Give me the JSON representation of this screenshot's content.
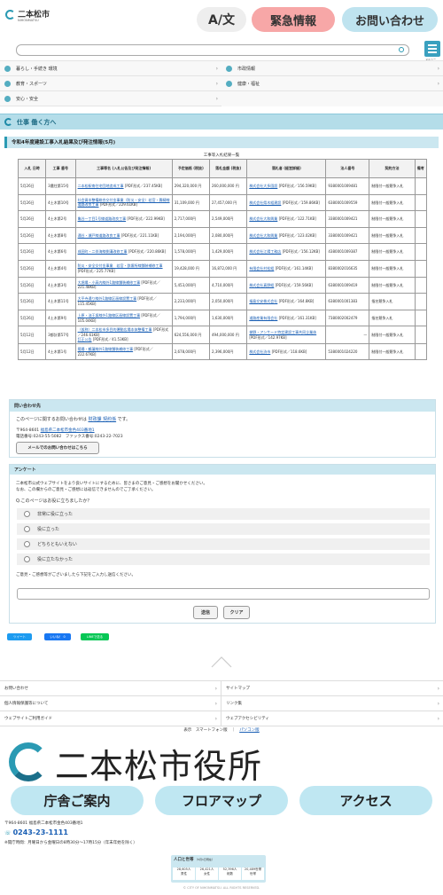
{
  "header": {
    "logo_text": "二本松市",
    "logo_sub": "NIHONMATSU",
    "lang_label": "A/文",
    "emergency_label": "緊急情報",
    "contact_label": "お問い合わせ",
    "menu_label": "メニュー"
  },
  "nav": [
    {
      "label": "暮らし・手続き 環境"
    },
    {
      "label": "市政情報"
    },
    {
      "label": "教育・スポーツ"
    },
    {
      "label": "健康・福祉"
    },
    {
      "label": "安心・安全"
    }
  ],
  "section_title": "仕事 働く方へ",
  "page_heading": "令和4年度建設工事入札結果及び発注情報(5月)",
  "table_caption": "工事等入札結果一覧",
  "table_headers": [
    "入札 日時",
    "工事 番号",
    "工事等名 (入札公告及び発注情報)",
    "予定価格 (税抜)",
    "落札金額 (税抜)",
    "落札者 (経営詳細)",
    "法人番号",
    "契約方法",
    "備考"
  ],
  "rows": [
    {
      "date": "5月26日",
      "no": "3農住第15号",
      "name_link": "二本松駅南住宅団地造成工事",
      "name_extra": " [PDF形式／237.45KB]",
      "price": "294,320,000 円",
      "bid": "260,000,000 円",
      "winner_link": "株式会社大多園設",
      "winner_extra": " [PDF形式／156.59KB]",
      "corp": "9380001009481",
      "method": "制限付一般競争入札",
      "note": ""
    },
    {
      "date": "5月26日",
      "no": "4土木第10号",
      "name_link": "社会資本整備総合交付金事業（防災・安全）若宮・舞騎線道路改良工事",
      "name_extra": " [PDF形式／229.61KB]",
      "price": "31,109,000 円",
      "bid": "27,457,000 円",
      "winner_link": "株式会社県木組建設",
      "winner_extra": " [PDF形式／159.86KB]",
      "corp": "6380001009559",
      "method": "制限付一般競争入札",
      "note": ""
    },
    {
      "date": "5月26日",
      "no": "4土木第2号",
      "name_link": "亀谷一丁目1号線道路改良工事",
      "name_extra": " [PDF形式／222.99KB]",
      "price": "2,717,000円",
      "bid": "2,549,000円",
      "winner_link": "株式会社大和興業",
      "winner_extra": " [PDF形式／122.71KB]",
      "corp": "3380001009421",
      "method": "制限付一般競争入札",
      "note": ""
    },
    {
      "date": "5月26日",
      "no": "4土木第8号",
      "name_link": "通谷・瀬戸線道路改良工事",
      "name_extra": " [PDF形式／221.11KB]",
      "price": "2,194,000円",
      "bid": "2,080,000円",
      "winner_link": "株式会社大和興業",
      "winner_extra": " [PDF形式／123.02KB]",
      "corp": "3380001009421",
      "method": "制限付一般競争入札",
      "note": ""
    },
    {
      "date": "5月26日",
      "no": "4土木第6号",
      "name_link": "成田町・二伴海線側溝改修工事",
      "name_extra": " [PDF形式／220.86KB]",
      "price": "1,578,000円",
      "bid": "1,429,000円",
      "winner_link": "株式会社江陽工務店",
      "winner_extra": " [PDF形式／156.12KB]",
      "corp": "4380001009387",
      "method": "制限付一般競争入札",
      "note": ""
    },
    {
      "date": "5月26日",
      "no": "4土木第4号",
      "name_link": "防災・安全交付金事業　若宮・鉄塀所線舗装補修工事",
      "name_extra": " [PDF形式／225.77KB]",
      "price": "19,428,000 円",
      "bid": "16,872,000 円",
      "winner_link": "有限会社村松組",
      "winner_extra": " [PDF形式／161.14KB]",
      "corp": "8380002016635",
      "method": "制限付一般競争入札",
      "note": ""
    },
    {
      "date": "5月26日",
      "no": "4土木第3号",
      "name_link": "大堀場・小高内線外1路線舗装補修工事",
      "name_extra": " [PDF形式／221.48KB]",
      "price": "5,453,000円",
      "bid": "4,710,000円",
      "winner_link": "株式会社真野組",
      "winner_extra": " [PDF形式／159.56KB]",
      "corp": "6380001009419",
      "method": "制限付一般競争入札",
      "note": ""
    },
    {
      "date": "5月26日",
      "no": "4土木第11号",
      "name_link": "大平寺通り線外1路線区画線設置工事",
      "name_extra": " [PDF形式／115.45KB]",
      "price": "2,233,000円",
      "bid": "2,050,000円",
      "winner_link": "福島交安株式会社",
      "winner_extra": " [PDF形式／164.8KB]",
      "corp": "6380001001383",
      "method": "指名競争入札",
      "note": ""
    },
    {
      "date": "5月26日",
      "no": "4土木第9号",
      "name_link": "上原・油王坂線外1路線区画線設置工事",
      "name_extra": " [PDF形式／105.04KB]",
      "price": "1,794,000円",
      "bid": "1,630,000円",
      "winner_link": "道路産業有限会社",
      "winner_extra": " [PDF形式／161.31KB]",
      "corp": "7380002002479",
      "method": "指名競争入札",
      "note": ""
    },
    {
      "date": "5月12日",
      "no": "3都計第57号",
      "name_link": "（仮称）二本松市多目的運動広場本体整備工事",
      "name_extra": " [PDF形式／246.61KB]",
      "name_link2": "訂正公告",
      "name_extra2": " [PDF形式／41.53KB]",
      "price": "624,556,000 円",
      "bid": "494,000,000 円",
      "winner_link": "誉野・アンサード特定建設工事共同企業体",
      "winner_extra": " [PDF形式／142.97KB]",
      "corp": "—",
      "method": "制限付一般競争入札",
      "note": ""
    },
    {
      "date": "5月12日",
      "no": "4土木第1号",
      "name_link": "陽場・鶴蓮線外1路線舗装補修工事",
      "name_extra": " [PDF形式／222.67KB]",
      "price": "2,678,000円",
      "bid": "2,396,000円",
      "winner_link": "株式会社渋市",
      "winner_extra": " [PDF形式／118.6KB]",
      "corp": "5380001024220",
      "method": "制限付一般競争入札",
      "note": ""
    }
  ],
  "inquiry": {
    "title": "問い合わせ先",
    "line_pre": "このページに関するお問い合わせは ",
    "dept": "財政課 契約係",
    "line_post": " です。",
    "postal": "〒964-8601 ",
    "address_link": "福島県二本松市金色403番地1",
    "phone": "電話番号:0243-55-5082　ファックス番号:0243-22-7023",
    "mail_button": "メールでのお問い合わせはこちら"
  },
  "survey": {
    "title": "アンケート",
    "desc1": "二本松市公式ウェブサイトをより良いサイトにするために、皆さまのご意見・ご感想をお聞かせください。",
    "desc2": "なお、この欄からのご意見・ご感想には返信できませんのでご了承ください。",
    "question": "Q.このページはお役に立ちましたか？",
    "options": [
      "非常に役に立った",
      "役に立った",
      "どちらともいえない",
      "役に立たなかった"
    ],
    "comment_label": "ご意見・ご感想等がございましたら下記をご入力し送信ください。",
    "submit": "送信",
    "clear": "クリア"
  },
  "share": {
    "tweet": "ツイート",
    "fb": "いいね！ 0",
    "line": "LINEで送る"
  },
  "footer_links": [
    {
      "label": "お問い合わせ"
    },
    {
      "label": "サイトマップ"
    },
    {
      "label": "個人情報保護等について"
    },
    {
      "label": "リンク集"
    },
    {
      "label": "ウェブサイトご利用ガイド"
    },
    {
      "label": "ウェブアクセシビリティ"
    }
  ],
  "display_mode": {
    "label": "表示",
    "smartphone": "スマートフォン版",
    "sep": "｜",
    "pc": "パソコン版"
  },
  "city_name": "二本松市役所",
  "buttons": {
    "office": "庁舎ご案内",
    "floor": "フロアマップ",
    "access": "アクセス"
  },
  "address": "〒964-8601 福島県二本松市金色403番地1",
  "tel": "0243-23-1111",
  "hours": "※開庁時間：月曜日から金曜日の8時30分～17時15分（年末年始を除く）",
  "population": {
    "title": "人口と世帯",
    "date": "（5月1日現在）",
    "stats": [
      {
        "v": "28,605人",
        "l": "男性"
      },
      {
        "v": "26,421人",
        "l": "女性"
      },
      {
        "v": "52,396人",
        "l": "総数"
      },
      {
        "v": "20,489世帯",
        "l": "世帯"
      }
    ]
  },
  "copyright": "© CITY OF NIHONMATSU. ALL RIGHTS RESERVED."
}
